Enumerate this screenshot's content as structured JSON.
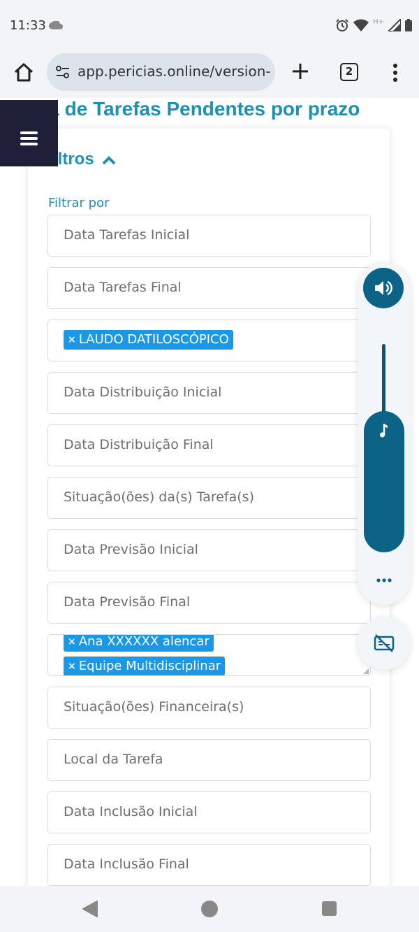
{
  "status_bar": {
    "time": "11:33",
    "network": "H+"
  },
  "browser": {
    "url": "app.pericias.online/version-",
    "tab_count": "2"
  },
  "page": {
    "title": "ta de Tarefas Pendentes por prazo",
    "filters_heading": "iltros",
    "filter_by_label": "Filtrar por",
    "fields": {
      "data_tarefas_inicial": "Data Tarefas Inicial",
      "data_tarefas_final": "Data Tarefas Final",
      "tipo_tag": "LAUDO DATILOSCÓPICO",
      "data_distribuicao_inicial": "Data Distribuição Inicial",
      "data_distribuicao_final": "Data Distribuição Final",
      "situacoes_tarefas": "Situação(ões) da(s) Tarefa(s)",
      "data_previsao_inicial": "Data Previsão Inicial",
      "data_previsao_final": "Data Previsão Final",
      "responsavel_tags": [
        "Ana XXXXXX alencar",
        "Equipe Multidisciplinar"
      ],
      "situacoes_financeiras": "Situação(ões) Financeira(s)",
      "local_tarefa": "Local da Tarefa",
      "data_inclusao_inicial": "Data Inclusão  Inicial",
      "data_inclusao_final": "Data Inclusão Final"
    },
    "tag_remove_symbol": "×"
  },
  "colors": {
    "accent": "#1e90b0",
    "tag": "#1a98e6",
    "menu_bg": "#1d1f36",
    "volume": "#0d6385"
  },
  "icons": [
    "cloud-icon",
    "alarm-icon",
    "wifi-icon",
    "signal-icon",
    "battery-icon",
    "home-icon",
    "site-settings-icon",
    "plus-icon",
    "more-vert-icon",
    "hamburger-icon",
    "chevron-up-icon",
    "volume-icon",
    "music-note-icon",
    "more-horiz-icon",
    "captions-off-icon",
    "back-icon",
    "nav-home-icon",
    "recents-icon"
  ]
}
